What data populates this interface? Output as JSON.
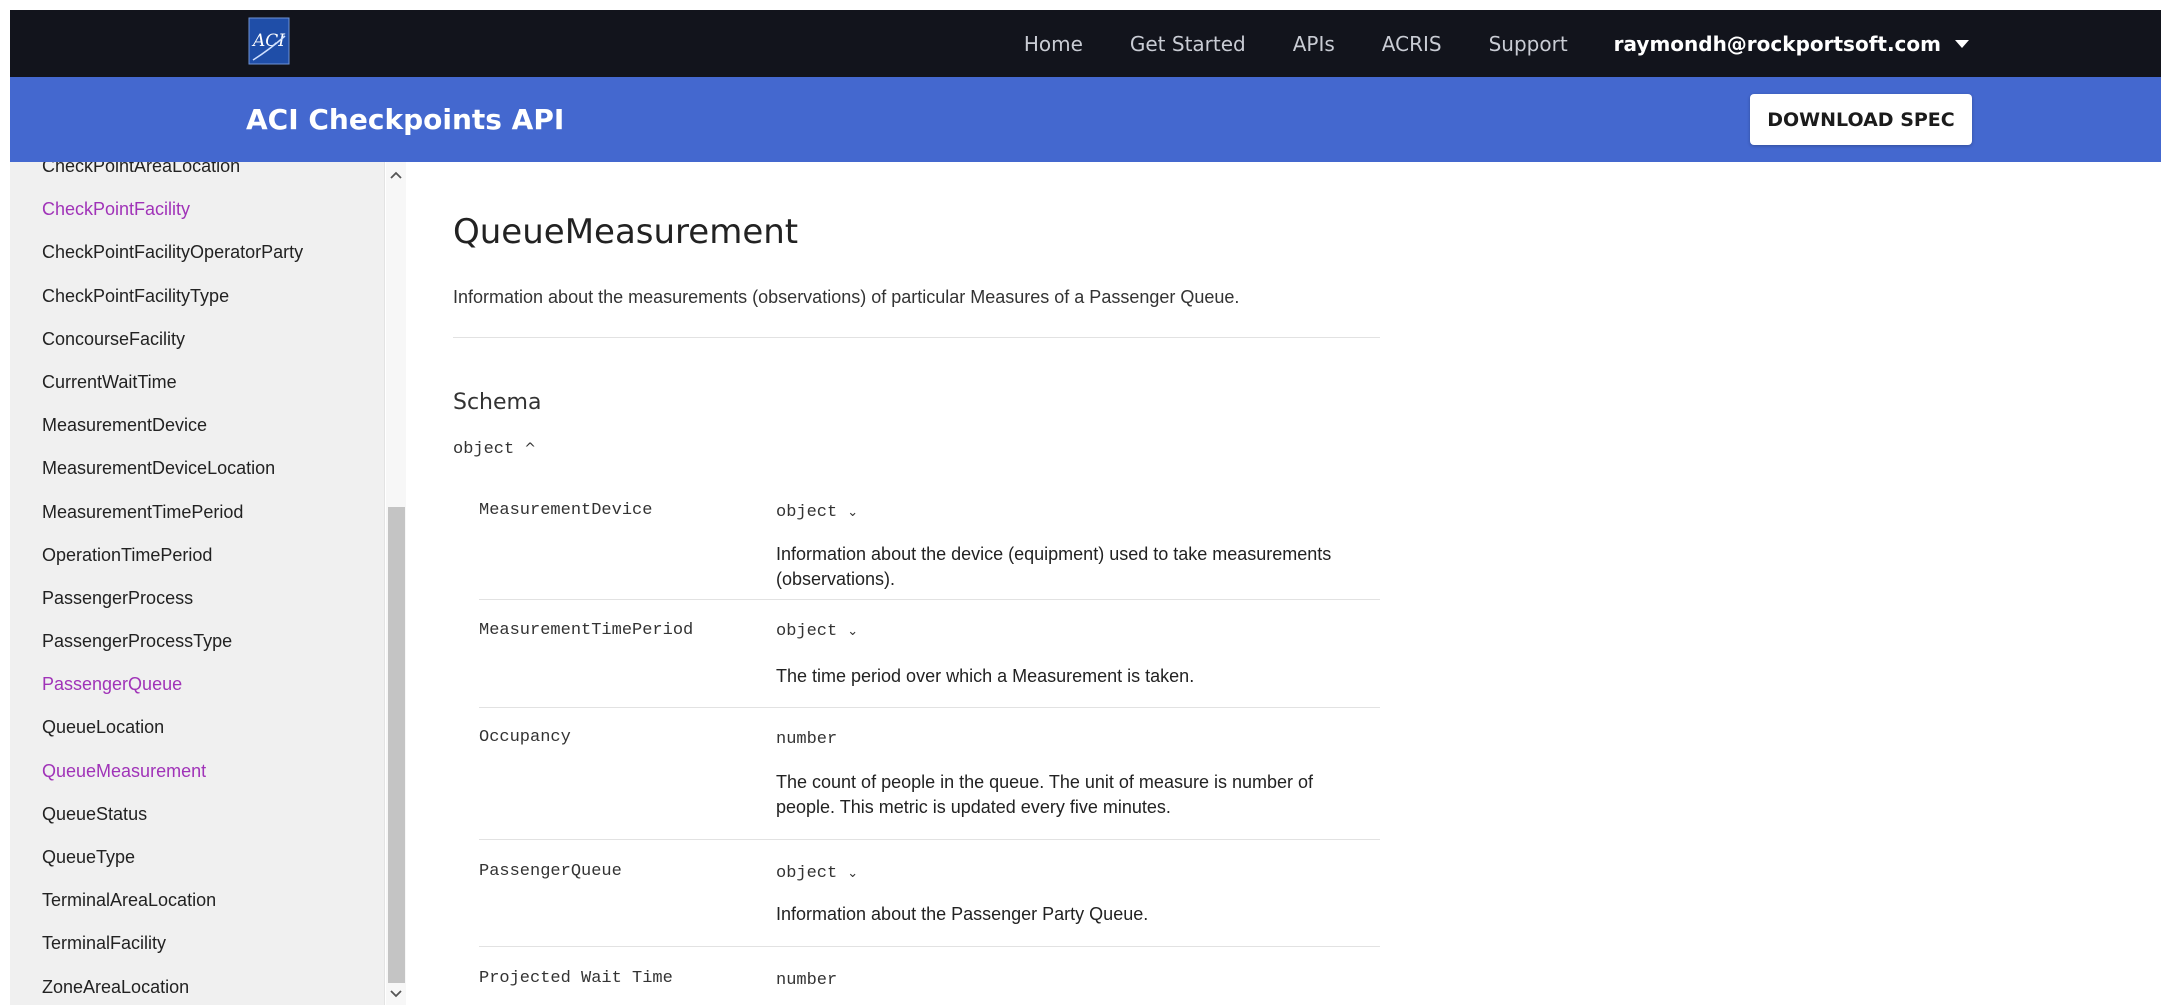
{
  "nav": {
    "logo_alt": "ACI",
    "links": [
      "Home",
      "Get Started",
      "APIs",
      "ACRIS",
      "Support"
    ],
    "user": "raymondh@rockportsoft.com"
  },
  "header": {
    "title": "ACI Checkpoints API",
    "download_label": "DOWNLOAD SPEC"
  },
  "sidebar": {
    "items": [
      {
        "label": "CheckPointAreaLocation",
        "visited": false
      },
      {
        "label": "CheckPointFacility",
        "visited": true
      },
      {
        "label": "CheckPointFacilityOperatorParty",
        "visited": false
      },
      {
        "label": "CheckPointFacilityType",
        "visited": false
      },
      {
        "label": "ConcourseFacility",
        "visited": false
      },
      {
        "label": "CurrentWaitTime",
        "visited": false
      },
      {
        "label": "MeasurementDevice",
        "visited": false
      },
      {
        "label": "MeasurementDeviceLocation",
        "visited": false
      },
      {
        "label": "MeasurementTimePeriod",
        "visited": false
      },
      {
        "label": "OperationTimePeriod",
        "visited": false
      },
      {
        "label": "PassengerProcess",
        "visited": false
      },
      {
        "label": "PassengerProcessType",
        "visited": false
      },
      {
        "label": "PassengerQueue",
        "visited": true
      },
      {
        "label": "QueueLocation",
        "visited": false
      },
      {
        "label": "QueueMeasurement",
        "visited": true
      },
      {
        "label": "QueueStatus",
        "visited": false
      },
      {
        "label": "QueueType",
        "visited": false
      },
      {
        "label": "TerminalAreaLocation",
        "visited": false
      },
      {
        "label": "TerminalFacility",
        "visited": false
      },
      {
        "label": "ZoneAreaLocation",
        "visited": false
      }
    ]
  },
  "main": {
    "title": "QueueMeasurement",
    "description": "Information about the measurements (observations) of particular Measures of a Passenger Queue.",
    "schema_heading": "Schema",
    "schema_type": "object",
    "properties": [
      {
        "name": "MeasurementDevice",
        "type": "object",
        "expandable": true,
        "description": "Information about the device (equipment) used to take measurements (observations)."
      },
      {
        "name": "MeasurementTimePeriod",
        "type": "object",
        "expandable": true,
        "description": "The time period over which a Measurement is taken."
      },
      {
        "name": "Occupancy",
        "type": "number",
        "expandable": false,
        "description": "The count of people in the queue. The unit of measure is number of people. This metric is updated every five minutes."
      },
      {
        "name": "PassengerQueue",
        "type": "object",
        "expandable": true,
        "description": "Information about the Passenger Party Queue."
      },
      {
        "name": "Projected Wait Time",
        "type": "number",
        "expandable": false,
        "description": ""
      }
    ]
  },
  "colors": {
    "navbar": "#12141c",
    "header": "#4468cf",
    "visited_link": "#a033b8"
  }
}
